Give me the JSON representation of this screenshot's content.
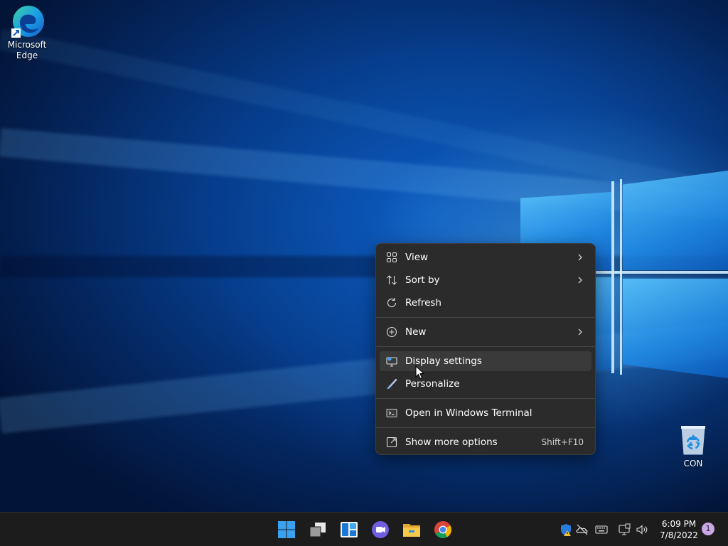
{
  "desktop": {
    "icons": [
      {
        "label": "Microsoft Edge",
        "icon": "edge-icon"
      },
      {
        "label": "CON",
        "icon": "recycle-bin-icon"
      }
    ]
  },
  "context_menu": {
    "items": [
      {
        "label": "View",
        "icon": "view-grid-icon",
        "submenu": true
      },
      {
        "label": "Sort by",
        "icon": "sort-icon",
        "submenu": true
      },
      {
        "label": "Refresh",
        "icon": "refresh-icon",
        "submenu": false
      },
      {
        "label": "New",
        "icon": "new-plus-icon",
        "submenu": true
      },
      {
        "label": "Display settings",
        "icon": "display-icon",
        "submenu": false,
        "hovered": true
      },
      {
        "label": "Personalize",
        "icon": "brush-icon",
        "submenu": false
      },
      {
        "label": "Open in Windows Terminal",
        "icon": "terminal-icon",
        "submenu": false
      },
      {
        "label": "Show more options",
        "icon": "more-options-icon",
        "shortcut": "Shift+F10"
      }
    ]
  },
  "taskbar": {
    "apps": [
      "start-icon",
      "task-view-icon",
      "widgets-icon",
      "teams-chat-icon",
      "file-explorer-icon",
      "chrome-icon"
    ],
    "tray": [
      "defender-icon",
      "onedrive-icon",
      "keyboard-icon",
      "network-icon",
      "volume-icon"
    ],
    "clock": {
      "time": "6:09 PM",
      "date": "7/8/2022"
    },
    "notification_count": "1"
  },
  "colors": {
    "menu_bg": "#2b2b2b",
    "taskbar_bg": "#1c1c1c",
    "accent": "#0a56b8"
  }
}
